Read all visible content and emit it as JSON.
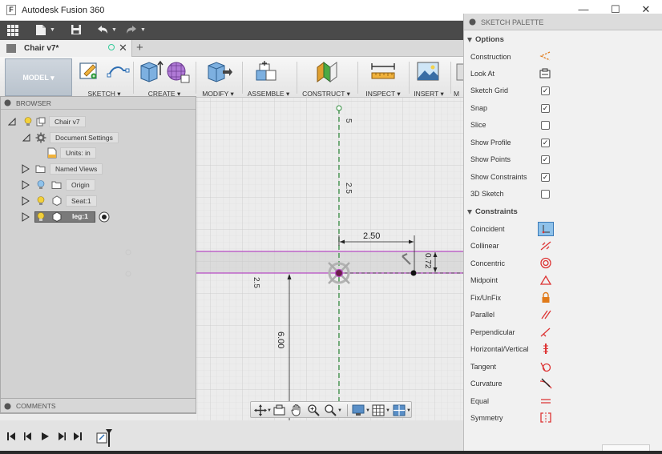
{
  "window": {
    "title": "Autodesk Fusion 360",
    "minimize": "—",
    "maximize": "☐",
    "close": "✕"
  },
  "document": {
    "tab_name": "Chair v7*",
    "close": "✕",
    "new_tab": "+"
  },
  "toolbar": {
    "workspace": "MODEL ▾",
    "groups": [
      "SKETCH ▾",
      "CREATE ▾",
      "MODIFY ▾",
      "ASSEMBLE ▾",
      "CONSTRUCT ▾",
      "INSPECT ▾",
      "INSERT ▾",
      "M"
    ]
  },
  "browser": {
    "title": "BROWSER",
    "nodes": {
      "root": "Chair v7",
      "doc_settings": "Document Settings",
      "units": "Units: in",
      "named_views": "Named Views",
      "origin": "Origin",
      "seat": "Seat:1",
      "leg": "leg:1"
    }
  },
  "comments": {
    "label": "COMMENTS"
  },
  "canvas": {
    "dims": {
      "top_vertical": "5",
      "mid_vertical": "2.5",
      "horizontal": "2.50",
      "right_vertical": "0.72",
      "left_vertical": "2.5",
      "bottom_vertical": "6.00"
    },
    "line_color": "#b64bc4",
    "axis_color": "#2e8b3a"
  },
  "palette": {
    "title": "SKETCH PALETTE",
    "options_title": "Options",
    "options": [
      {
        "label": "Construction",
        "control": "icon"
      },
      {
        "label": "Look At",
        "control": "icon"
      },
      {
        "label": "Sketch Grid",
        "checked": true
      },
      {
        "label": "Snap",
        "checked": true
      },
      {
        "label": "Slice",
        "checked": false
      },
      {
        "label": "Show Profile",
        "checked": true
      },
      {
        "label": "Show Points",
        "checked": true
      },
      {
        "label": "Show Constraints",
        "checked": true
      },
      {
        "label": "3D Sketch",
        "checked": false
      }
    ],
    "constraints_title": "Constraints",
    "constraints": [
      {
        "label": "Coincident",
        "icon": "coincident-icon"
      },
      {
        "label": "Collinear",
        "icon": "collinear-icon"
      },
      {
        "label": "Concentric",
        "icon": "concentric-icon"
      },
      {
        "label": "Midpoint",
        "icon": "midpoint-icon"
      },
      {
        "label": "Fix/UnFix",
        "icon": "lock-icon"
      },
      {
        "label": "Parallel",
        "icon": "parallel-icon"
      },
      {
        "label": "Perpendicular",
        "icon": "perpendicular-icon"
      },
      {
        "label": "Horizontal/Vertical",
        "icon": "horizontal-vertical-icon"
      },
      {
        "label": "Tangent",
        "icon": "tangent-icon"
      },
      {
        "label": "Curvature",
        "icon": "curvature-icon"
      },
      {
        "label": "Equal",
        "icon": "equal-icon"
      },
      {
        "label": "Symmetry",
        "icon": "symmetry-icon"
      }
    ],
    "check_glyph": "✓"
  }
}
